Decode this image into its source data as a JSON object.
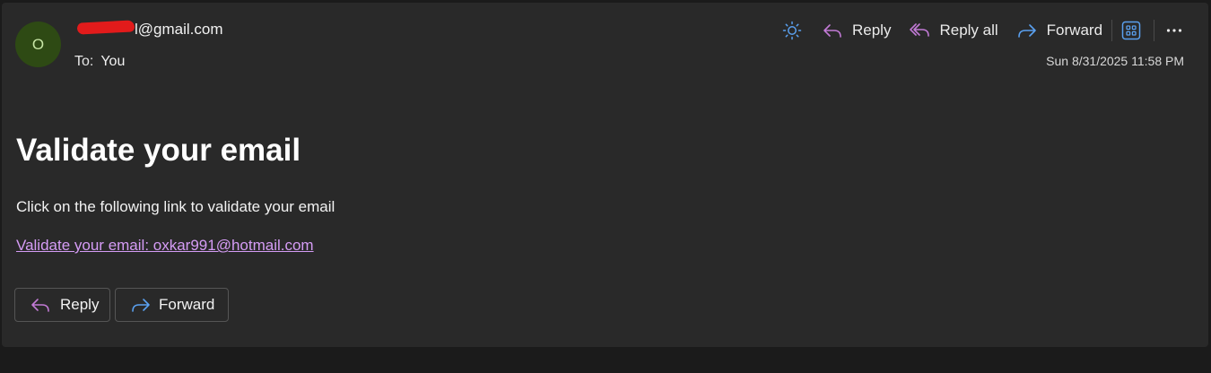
{
  "message": {
    "avatar_initial": "O",
    "sender_email_visible": "l@gmail.com",
    "to_label": "To:",
    "to_value": "You",
    "timestamp": "Sun 8/31/2025 11:58 PM"
  },
  "toolbar": {
    "reply_label": "Reply",
    "reply_all_label": "Reply all",
    "forward_label": "Forward"
  },
  "body": {
    "subject": "Validate your email",
    "text": "Click on the following link to validate your email",
    "link_text": "Validate your email: oxkar991@hotmail.com"
  },
  "footer": {
    "reply_label": "Reply",
    "forward_label": "Forward"
  },
  "colors": {
    "background": "#1b1b1b",
    "card": "#292929",
    "avatar_bg": "#2e4a14",
    "link": "#d59cf5",
    "reply_icon": "#c27ad6",
    "forward_icon": "#5aa0ef",
    "redaction": "#e21b1b"
  },
  "icons": [
    "sun-icon",
    "reply-icon",
    "reply-all-icon",
    "forward-icon",
    "apps-icon",
    "more-icon"
  ]
}
